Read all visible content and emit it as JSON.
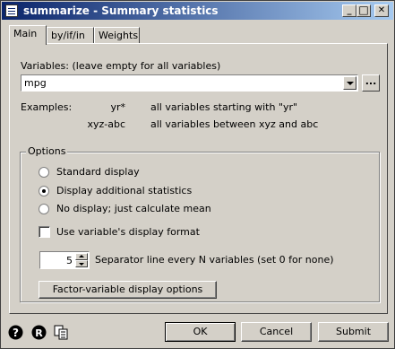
{
  "window": {
    "title": "summarize - Summary statistics",
    "controls": {
      "minimize": "_",
      "maximize": "□",
      "close": "✕"
    }
  },
  "tabs": [
    {
      "label": "Main"
    },
    {
      "label": "by/if/in"
    },
    {
      "label": "Weights"
    }
  ],
  "main": {
    "variables_label": "Variables: (leave empty for all variables)",
    "variables_value": "mpg",
    "browse_label": "...",
    "examples_label": "Examples:",
    "examples": [
      {
        "pattern": "yr*",
        "description": "all variables starting with \"yr\""
      },
      {
        "pattern": "xyz-abc",
        "description": "all variables between xyz and abc"
      }
    ]
  },
  "options": {
    "title": "Options",
    "radios": [
      {
        "label": "Standard display",
        "selected": false
      },
      {
        "label": "Display additional statistics",
        "selected": true
      },
      {
        "label": "No display; just calculate mean",
        "selected": false
      }
    ],
    "format_checkbox_label": "Use variable's display format",
    "format_checked": false,
    "separator_value": "5",
    "separator_label": "Separator line every N variables (set 0 for none)",
    "factor_button_label": "Factor-variable display options"
  },
  "footer": {
    "ok_label": "OK",
    "cancel_label": "Cancel",
    "submit_label": "Submit"
  }
}
